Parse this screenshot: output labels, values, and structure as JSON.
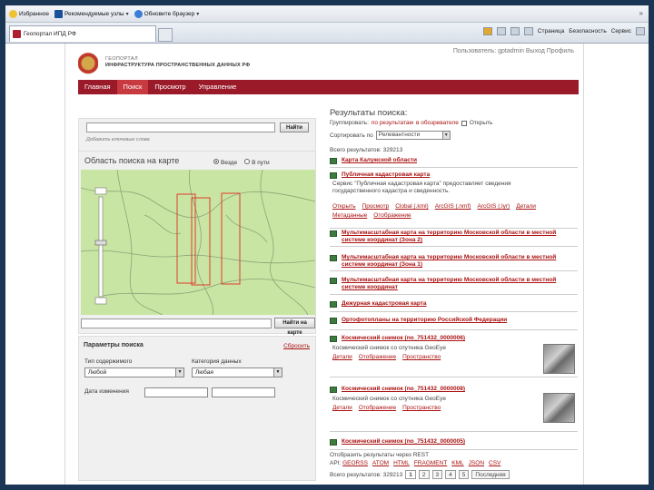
{
  "browser": {
    "favorites_label": "Избранное",
    "favorites_items": [
      "Рекомендуемые узлы",
      "Обновите браузер"
    ],
    "tab_title": "Геопортал ИПД РФ",
    "tools": [
      "Страница",
      "Безопасность",
      "Сервис"
    ]
  },
  "header": {
    "brand_line1": "ГЕОПОРТАЛ",
    "brand_line2": "ИНФРАСТРУКТУРА ПРОСТРАНСТВЕННЫХ ДАННЫХ РФ",
    "user_line": "Пользователь: gptadmin  Выход  Профиль"
  },
  "nav": {
    "items": [
      {
        "label": "Главная"
      },
      {
        "label": "Поиск"
      },
      {
        "label": "Просмотр"
      },
      {
        "label": "Управление"
      }
    ]
  },
  "search": {
    "button_label": "Найти",
    "hint": "Добавить ключевые слова"
  },
  "map": {
    "title": "Область поиска на карте",
    "toggle_all": "Везде",
    "toggle_in": "В пути",
    "search_button": "Найти на карте"
  },
  "params": {
    "title": "Параметры поиска",
    "reset": "Сбросить",
    "content_type_label": "Тип содержимого",
    "content_type_value": "Любой",
    "data_category_label": "Категория данных",
    "data_category_value": "Любая",
    "date_label": "Дата изменения"
  },
  "results": {
    "title": "Результаты поиска:",
    "group_label": "Группировать:",
    "group_opt1": "по результатам",
    "group_opt2": "в обозревателе",
    "group_opt3": "Открыть",
    "sort_label": "Сортировать по",
    "sort_value": "Релевантности",
    "total": "Всего результатов: 329213",
    "items": [
      {
        "title": "Карта Калужской области"
      },
      {
        "title": "Публичная кадастровая карта",
        "desc": "Сервис \"Публичная кадастровая карта\" предоставляет сведения государственного кадастра и сведенность.",
        "links": [
          "Открыть",
          "Просмотр",
          "Clobal (.kml)",
          "ArcGIS (.nmf)",
          "ArcGIS (.lyr)",
          "Детали"
        ],
        "links2": [
          "Метаданные",
          "Отображение"
        ]
      },
      {
        "title": "Мультимасштабная карта на территорию Московской области в местной системе координат (Зона 2)"
      },
      {
        "title": "Мультимасштабная карта на территорию Московской области в местной системе координат (Зона 1)"
      },
      {
        "title": "Мультимасштабная карта на территорию Московской области в местной системе координат"
      },
      {
        "title": "Дежурная кадастровая карта"
      },
      {
        "title": "Ортофотопланы на территорию Российской Федерации"
      },
      {
        "title": "Космический снимок (no_751432_0000006)",
        "desc": "Космический снимок со спутника GeoEye",
        "links": [
          "Детали",
          "Отображение",
          "Пространство"
        ]
      },
      {
        "title": "Космический снимок (no_751432_0000008)",
        "desc": "Космический снимок со спутника GeoEye",
        "links": [
          "Детали",
          "Отображение",
          "Пространство"
        ]
      },
      {
        "title": "Космический снимок (no_751432_0000005)"
      }
    ],
    "rest_label": "Отобразить результаты через REST",
    "api_label": "API:",
    "api_links": [
      "GEORSS",
      "ATOM",
      "HTML",
      "FRAGMENT",
      "KML",
      "JSON",
      "CSV"
    ],
    "pager_prefix": "Всего результатов: 329213",
    "pages": [
      "1",
      "2",
      "3",
      "4",
      "5"
    ],
    "next": "Последняя"
  }
}
